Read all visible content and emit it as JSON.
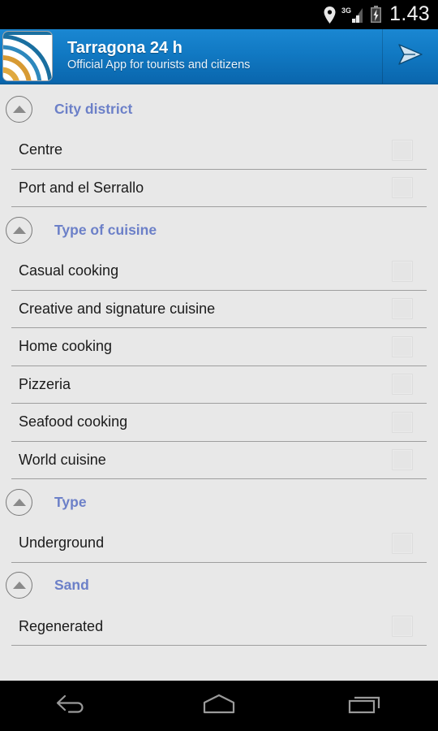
{
  "statusbar": {
    "time": "1.43",
    "icons": [
      "location-pin-icon",
      "signal-3g-icon",
      "battery-charging-icon"
    ],
    "network_label": "3G"
  },
  "appbar": {
    "title": "Tarragona 24 h",
    "subtitle": "Official App for tourists and citizens",
    "icon_name": "tarragona-app-icon",
    "action_icon": "send-icon"
  },
  "colors": {
    "header_blue_top": "#1a87d2",
    "header_blue_bottom": "#0a66ad",
    "section_title": "#6c80c8",
    "background": "#e8e8e8",
    "divider": "#9e9e9e",
    "text": "#1b1b1b"
  },
  "sections": [
    {
      "title": "City district",
      "collapse_icon": "triangle-up-icon",
      "items": [
        {
          "label": "Centre",
          "checked": false
        },
        {
          "label": "Port and el Serrallo",
          "checked": false
        }
      ]
    },
    {
      "title": "Type of cuisine",
      "collapse_icon": "triangle-up-icon",
      "items": [
        {
          "label": "Casual cooking",
          "checked": false
        },
        {
          "label": "Creative and signature cuisine",
          "checked": false
        },
        {
          "label": "Home cooking",
          "checked": false
        },
        {
          "label": "Pizzeria",
          "checked": false
        },
        {
          "label": "Seafood cooking",
          "checked": false
        },
        {
          "label": "World cuisine",
          "checked": false
        }
      ]
    },
    {
      "title": "Type",
      "collapse_icon": "triangle-up-icon",
      "items": [
        {
          "label": "Underground",
          "checked": false
        }
      ]
    },
    {
      "title": "Sand",
      "collapse_icon": "triangle-up-icon",
      "items": [
        {
          "label": "Regenerated",
          "checked": false
        }
      ]
    }
  ],
  "navbar": {
    "buttons": [
      {
        "name": "back-button",
        "icon": "back-arrow-icon"
      },
      {
        "name": "home-button",
        "icon": "home-icon"
      },
      {
        "name": "recents-button",
        "icon": "recents-icon"
      }
    ]
  }
}
